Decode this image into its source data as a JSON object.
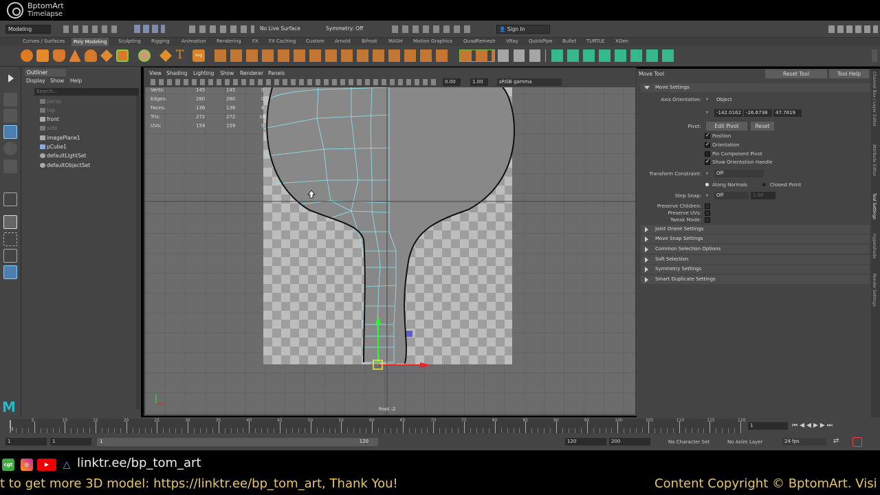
{
  "header": {
    "app_name": "BptomArt",
    "subtitle": "Timelapse"
  },
  "statusline": {
    "mode": "Modeling",
    "live_surface": "No Live Surface",
    "symmetry": "Symmetry: Off",
    "sign_in": "Sign In"
  },
  "shelf_tabs": [
    "Curves / Surfaces",
    "Poly Modeling",
    "Sculpting",
    "Rigging",
    "Animation",
    "Rendering",
    "FX",
    "FX Caching",
    "Custom",
    "Arnold",
    "Bifrost",
    "MASH",
    "Motion Graphics",
    "QuadRemesh",
    "VRay",
    "QuickPipe",
    "Bullet",
    "TURTLE",
    "XGen"
  ],
  "outliner": {
    "title": "Outliner",
    "menus": [
      "Display",
      "Show",
      "Help"
    ],
    "search_placeholder": "Search...",
    "items": [
      "persp",
      "top",
      "front",
      "side",
      "imagePlane1",
      "pCube1",
      "defaultLightSet",
      "defaultObjectSet"
    ]
  },
  "viewport": {
    "menus": [
      "View",
      "Shading",
      "Lighting",
      "Show",
      "Renderer",
      "Panels"
    ],
    "exposure": "0.00",
    "gamma": "1.00",
    "color_space": "sRGB gamma",
    "camera_label": "front -Z",
    "hud": {
      "rows": [
        {
          "label": "Verts:",
          "a": "145",
          "b": "145",
          "c": "0"
        },
        {
          "label": "Edges:",
          "a": "280",
          "b": "280",
          "c": "0"
        },
        {
          "label": "Faces:",
          "a": "136",
          "b": "136",
          "c": "8"
        },
        {
          "label": "Tris:",
          "a": "272",
          "b": "272",
          "c": "16"
        },
        {
          "label": "UVs:",
          "a": "159",
          "b": "159",
          "c": "0"
        }
      ]
    }
  },
  "tool_settings": {
    "title": "Move Tool",
    "reset_label": "Reset Tool",
    "help_label": "Tool Help",
    "section": "Move Settings",
    "axis_orientation_label": "Axis Orientation:",
    "axis_orientation": "Object",
    "coords": [
      "-142.0162",
      "-26.6738",
      "47.7619"
    ],
    "pivot_label": "Pivot:",
    "edit_pivot": "Edit Pivot",
    "reset": "Reset",
    "checks": [
      "Position",
      "Orientation",
      "Pin Component Pivot",
      "Show Orientation Handle"
    ],
    "transform_constraint_label": "Transform Constraint:",
    "transform_constraint": "Off",
    "along_normals": "Along Normals",
    "closest_point": "Closest Point",
    "step_snap_label": "Step Snap:",
    "step_snap": "Off",
    "step_value": "1.00",
    "preserve": [
      "Preserve Children:",
      "Preserve UVs:",
      "Tweak Mode:"
    ],
    "sections": [
      "Joint Orient Settings",
      "Move Snap Settings",
      "Common Selection Options",
      "Soft Selection",
      "Symmetry Settings",
      "Smart Duplicate Settings"
    ]
  },
  "side_tabs": [
    "Channel Box / Layer Editor",
    "Attribute Editor",
    "Tool Settings",
    "Hypershade",
    "Render Settings"
  ],
  "timeline": {
    "ticks": [
      "5",
      "10",
      "15",
      "20",
      "25",
      "30",
      "35",
      "40",
      "45",
      "50",
      "55",
      "60",
      "65",
      "70",
      "75",
      "80",
      "85",
      "90",
      "95",
      "100",
      "105",
      "110",
      "115",
      "120"
    ],
    "current_frame": "1"
  },
  "range": {
    "start": "1",
    "start2": "1",
    "slider_start": "1",
    "slider_end": "120",
    "end": "120",
    "end2": "200",
    "character_set": "No Character Set",
    "anim_layer": "No Anim Layer",
    "fps": "24 fps"
  },
  "footer": {
    "link": "linktr.ee/bp_tom_art",
    "message": "t to get more 3D model: https://linktr.ee/bp_tom_art, Thank You!",
    "copyright": "Content Copyright © BptomArt. Visi"
  }
}
